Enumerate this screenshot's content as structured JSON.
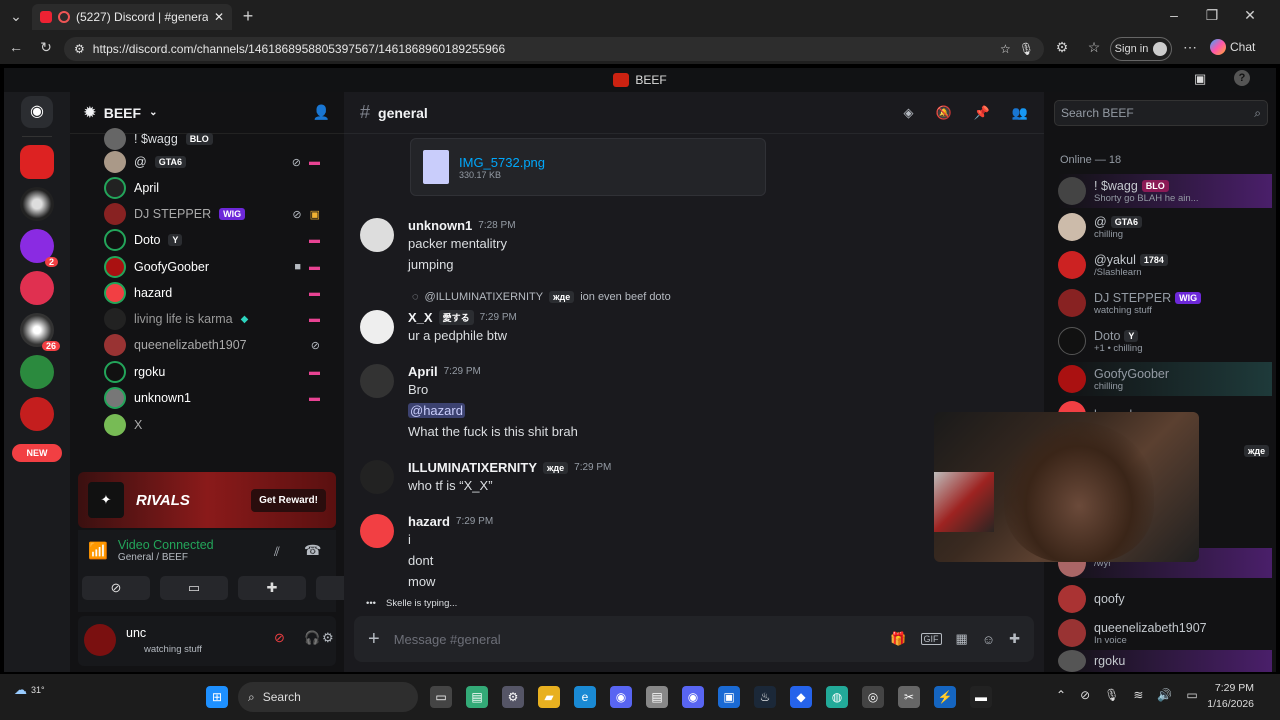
{
  "browser": {
    "tab_title": "(5227) Discord | #general | BE",
    "url": "https://discord.com/channels/1461868958805397567/1461868960189255966",
    "signin": "Sign in",
    "chat": "Chat"
  },
  "window_title": "BEEF",
  "server": {
    "name": "BEEF",
    "new_badge": "NEW"
  },
  "guild_badges": [
    "2",
    "26"
  ],
  "voice_members": [
    {
      "name": "! $wagg",
      "tag": "BLO"
    },
    {
      "name": "@",
      "tag": "GTA6"
    },
    {
      "name": "April",
      "tag": ""
    },
    {
      "name": "DJ STEPPER",
      "tag": "WIG"
    },
    {
      "name": "Doto",
      "tag": "Y"
    },
    {
      "name": "GoofyGoober",
      "tag": ""
    },
    {
      "name": "hazard",
      "tag": ""
    },
    {
      "name": "living life is karma",
      "tag": ""
    },
    {
      "name": "queenelizabeth1907",
      "tag": ""
    },
    {
      "name": "rgoku",
      "tag": ""
    },
    {
      "name": "unknown1",
      "tag": ""
    },
    {
      "name": "X",
      "tag": ""
    }
  ],
  "promo": {
    "brand": "RIVALS",
    "button": "Get Reward!"
  },
  "voice": {
    "status": "Video Connected",
    "channel": "General / BEEF"
  },
  "user": {
    "name": "unc",
    "status": "watching stuff"
  },
  "chat": {
    "channel": "general",
    "search_placeholder": "Search BEEF",
    "composer_placeholder": "Message #general",
    "typing": "Skelle is typing...",
    "attachment": {
      "name": "IMG_5732.png",
      "size": "330.17 KB"
    },
    "messages": [
      {
        "author": "unknown1",
        "time": "7:28 PM",
        "lines": [
          "packer mentalitry",
          "jumping"
        ]
      },
      {
        "reply_author": "@ILLUMINATIXERNITY",
        "reply_tag": "жде",
        "reply_text": "ion even beef doto",
        "author": "X_X",
        "tag": "愛する",
        "time": "7:29 PM",
        "lines": [
          "ur a pedphile btw"
        ]
      },
      {
        "author": "April",
        "time": "7:29 PM",
        "lines": [
          "Bro",
          "@hazard",
          "What the fuck is this shit brah"
        ]
      },
      {
        "author": "ILLUMINATIXERNITY",
        "tag": "жде",
        "time": "7:29 PM",
        "lines": [
          "who tf is “X_X”"
        ]
      },
      {
        "author": "hazard",
        "time": "7:29 PM",
        "lines": [
          "i",
          "dont",
          "mow"
        ]
      }
    ]
  },
  "members": {
    "header": "Online — 18",
    "list": [
      {
        "name": "! $wagg",
        "tag": "BLO",
        "status": "Shorty go BLAH he ain..."
      },
      {
        "name": "@",
        "tag": "GTA6",
        "status": "chilling"
      },
      {
        "name": "@yakul",
        "tag": "1784",
        "status": "/Slashlearn"
      },
      {
        "name": "DJ STEPPER",
        "tag": "WIG",
        "status": "watching stuff"
      },
      {
        "name": "Doto",
        "tag": "Y",
        "status": "+1 • chilling"
      },
      {
        "name": "GoofyGoober",
        "tag": "",
        "status": "chilling"
      },
      {
        "name": "hazard",
        "tag": "",
        "status": ""
      },
      {
        "name": "",
        "tag": "жде",
        "status": ""
      },
      {
        "name": "",
        "tag": "",
        "status": "/wyr"
      },
      {
        "name": "qoofy",
        "tag": "",
        "status": ""
      },
      {
        "name": "queenelizabeth1907",
        "tag": "",
        "status": "In voice"
      },
      {
        "name": "rgoku",
        "tag": "",
        "status": ""
      }
    ]
  },
  "taskbar": {
    "temp": "31°",
    "search": "Search",
    "time": "7:29 PM",
    "date": "1/16/2026"
  },
  "colors": {
    "green": "#23a55a",
    "red": "#f23f43",
    "blurple": "#5865f2",
    "link": "#00a8fc"
  }
}
